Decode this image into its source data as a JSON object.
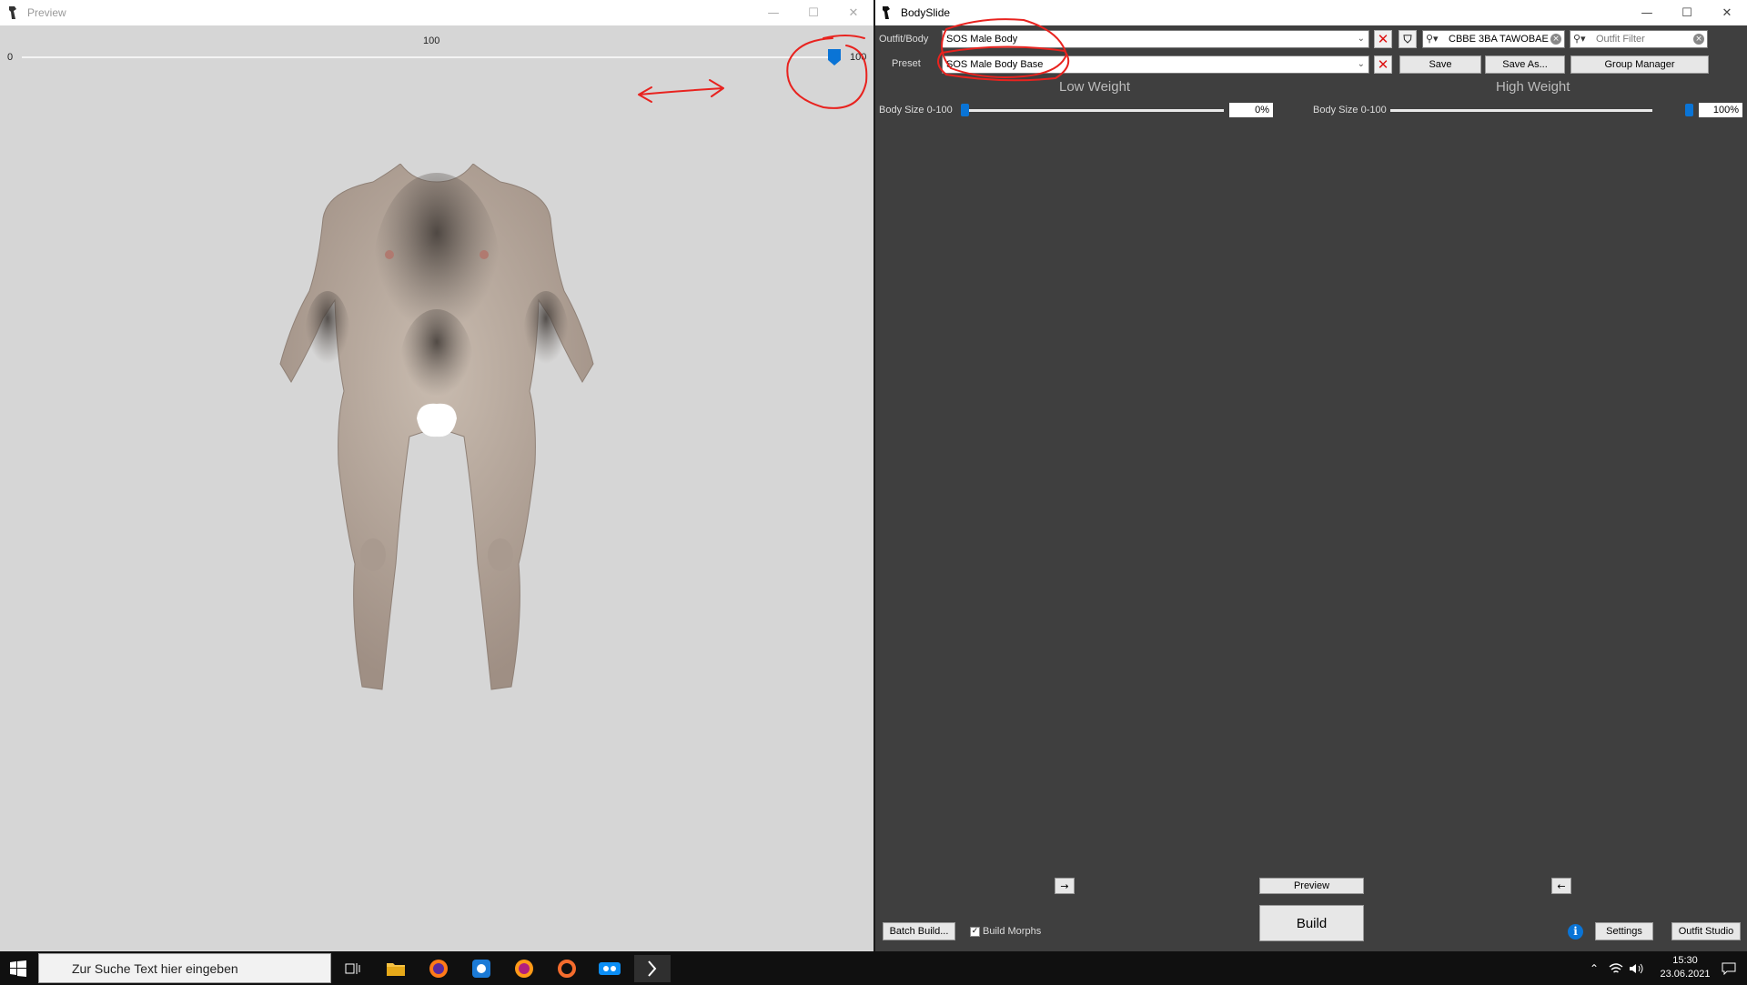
{
  "preview": {
    "title": "Preview",
    "slider": {
      "min_label": "0",
      "value_label": "100",
      "max_label": "100",
      "value": 100
    }
  },
  "bodyslide": {
    "title": "BodySlide",
    "outfit_label": "Outfit/Body",
    "outfit_value": "SOS Male Body",
    "preset_label": "Preset",
    "preset_value": "SOS Male Body Base",
    "group_filter_value": "CBBE 3BA TAWOBAE",
    "outfit_filter_placeholder": "Outfit Filter",
    "save_label": "Save",
    "save_as_label": "Save As...",
    "group_manager_label": "Group Manager",
    "low_weight_title": "Low Weight",
    "high_weight_title": "High Weight",
    "low_slider": {
      "label": "Body Size 0-100",
      "value": "0%",
      "fraction": 0
    },
    "high_slider": {
      "label": "Body Size 0-100",
      "value": "100%",
      "fraction": 1
    },
    "left_arrow_label": "→",
    "right_arrow_label": "←",
    "preview_label": "Preview",
    "build_label": "Build",
    "batch_build_label": "Batch Build...",
    "build_morphs_label": "Build Morphs",
    "build_morphs_checked": true,
    "settings_label": "Settings",
    "outfit_studio_label": "Outfit Studio"
  },
  "taskbar": {
    "search_placeholder": "Zur Suche Text hier eingeben",
    "time": "15:30",
    "date": "23.06.2021"
  },
  "colors": {
    "accent": "#0a74d6",
    "annotation": "#e8231f",
    "panel": "#3f3f3f"
  }
}
